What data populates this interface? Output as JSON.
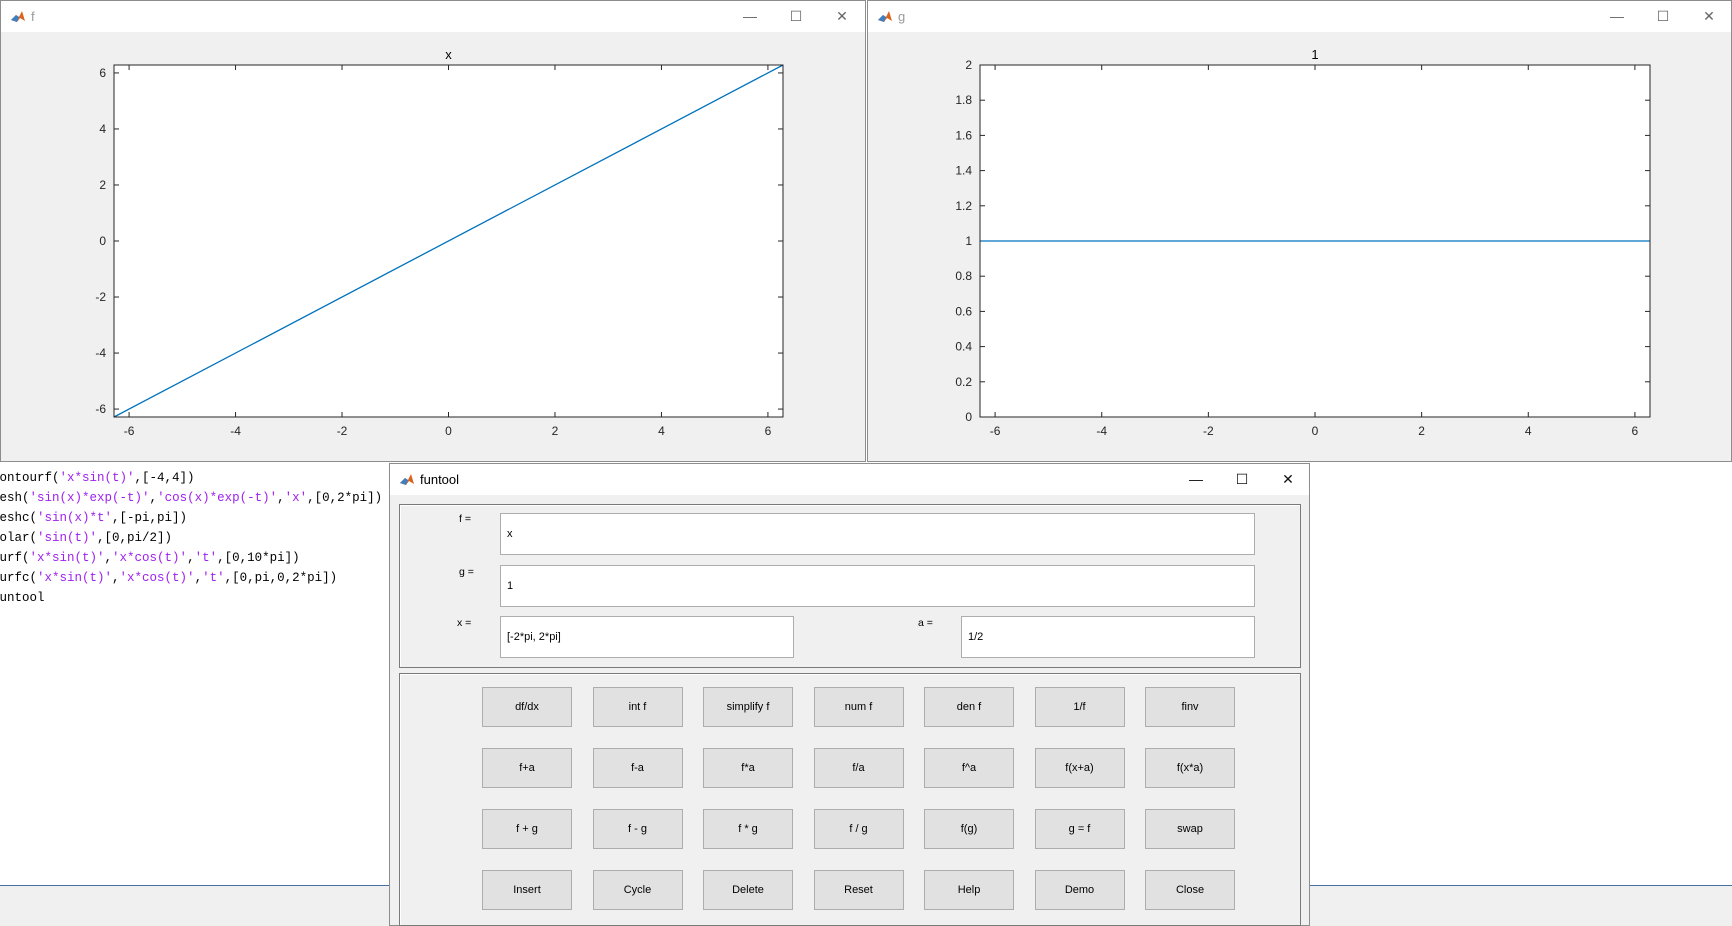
{
  "command_window": {
    "lines": [
      [
        {
          "t": "contourf("
        },
        {
          "t": "'x*sin(t)'",
          "s": 1
        },
        {
          "t": ",[-4,4])"
        }
      ],
      [
        {
          "t": "mesh("
        },
        {
          "t": "'sin(x)*exp(-t)'",
          "s": 1
        },
        {
          "t": ","
        },
        {
          "t": "'cos(x)*exp(-t)'",
          "s": 1
        },
        {
          "t": ","
        },
        {
          "t": "'x'",
          "s": 1
        },
        {
          "t": ",[0,2*pi])"
        }
      ],
      [
        {
          "t": "meshc("
        },
        {
          "t": "'sin(x)*t'",
          "s": 1
        },
        {
          "t": ",[-pi,pi])"
        }
      ],
      [
        {
          "t": "polar("
        },
        {
          "t": "'sin(t)'",
          "s": 1
        },
        {
          "t": ",[0,pi/2])"
        }
      ],
      [
        {
          "t": "surf("
        },
        {
          "t": "'x*sin(t)'",
          "s": 1
        },
        {
          "t": ","
        },
        {
          "t": "'x*cos(t)'",
          "s": 1
        },
        {
          "t": ","
        },
        {
          "t": "'t'",
          "s": 1
        },
        {
          "t": ",[0,10*pi])"
        }
      ],
      [
        {
          "t": "surfc("
        },
        {
          "t": "'x*sin(t)'",
          "s": 1
        },
        {
          "t": ","
        },
        {
          "t": "'x*cos(t)'",
          "s": 1
        },
        {
          "t": ","
        },
        {
          "t": "'t'",
          "s": 1
        },
        {
          "t": ",[0,pi,0,2*pi])"
        }
      ],
      [
        {
          "t": "funtool"
        }
      ]
    ]
  },
  "colors": {
    "line": "#0072bd",
    "string": "#a020f0",
    "matlab_icon": "#d9641e"
  },
  "window_controls": {
    "minimize": "—",
    "maximize": "☐",
    "close": "✕"
  },
  "figure_f": {
    "window_title": "f"
  },
  "figure_g": {
    "window_title": "g"
  },
  "chart_data": [
    {
      "type": "line",
      "title": "x",
      "xlim": [
        -6.2832,
        6.2832
      ],
      "ylim": [
        -6.2832,
        6.2832
      ],
      "xticks": [
        -6,
        -4,
        -2,
        0,
        2,
        4,
        6
      ],
      "yticks": [
        -6,
        -4,
        -2,
        0,
        2,
        4,
        6
      ],
      "series": [
        {
          "x": [
            -6.2832,
            6.2832
          ],
          "y": [
            -6.2832,
            6.2832
          ]
        }
      ],
      "grid": false
    },
    {
      "type": "line",
      "title": "1",
      "xlim": [
        -6.2832,
        6.2832
      ],
      "ylim": [
        0,
        2
      ],
      "xticks": [
        -6,
        -4,
        -2,
        0,
        2,
        4,
        6
      ],
      "yticks": [
        0,
        0.2,
        0.4,
        0.6,
        0.8,
        1,
        1.2,
        1.4,
        1.6,
        1.8,
        2
      ],
      "series": [
        {
          "x": [
            -6.2832,
            6.2832
          ],
          "y": [
            1,
            1
          ]
        }
      ],
      "grid": false
    }
  ],
  "funtool": {
    "window_title": "funtool",
    "f_label": "f =",
    "f_value": "x",
    "g_label": "g =",
    "g_value": "1",
    "x_label": "x =",
    "x_value": "[-2*pi, 2*pi]",
    "a_label": "a =",
    "a_value": "1/2",
    "button_rows": [
      [
        "df/dx",
        "int f",
        "simplify f",
        "num f",
        "den f",
        "1/f",
        "finv"
      ],
      [
        "f+a",
        "f-a",
        "f*a",
        "f/a",
        "f^a",
        "f(x+a)",
        "f(x*a)"
      ],
      [
        "f + g",
        "f - g",
        "f * g",
        "f / g",
        "f(g)",
        "g = f",
        "swap"
      ],
      [
        "Insert",
        "Cycle",
        "Delete",
        "Reset",
        "Help",
        "Demo",
        "Close"
      ]
    ]
  }
}
